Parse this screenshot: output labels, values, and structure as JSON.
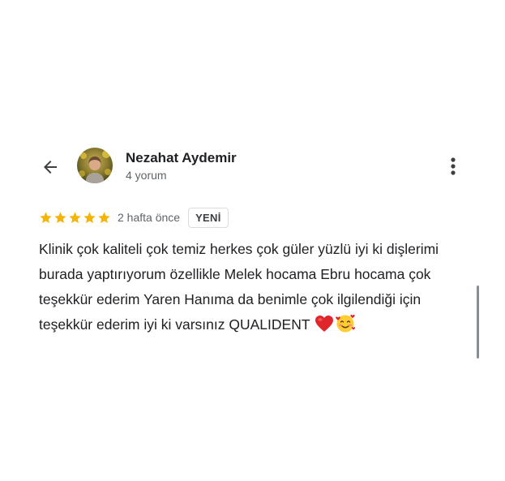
{
  "reviewer": {
    "name": "Nezahat Aydemir",
    "review_count": "4 yorum"
  },
  "icons": {
    "back": "arrow-back-icon",
    "more": "more-vert-icon",
    "star": "star-icon",
    "heart": "red-heart-emoji",
    "smile": "smiling-face-with-hearts-emoji"
  },
  "review": {
    "rating": 5,
    "rating_max": 5,
    "date": "2 hafta önce",
    "badge": "YENİ",
    "text": "Klinik çok kaliteli çok temiz herkes çok güler yüzlü iyi ki dişlerimi burada yaptırıyorum özellikle Melek hocama Ebru hocama çok teşekkür ederim Yaren Hanıma da benimle çok ilgilendiği için teşekkür ederim iyi ki varsınız QUALIDENT"
  },
  "colors": {
    "star": "#f4b400",
    "text": "#202124",
    "secondary": "#5f6368",
    "badge_border": "#dadce0"
  }
}
